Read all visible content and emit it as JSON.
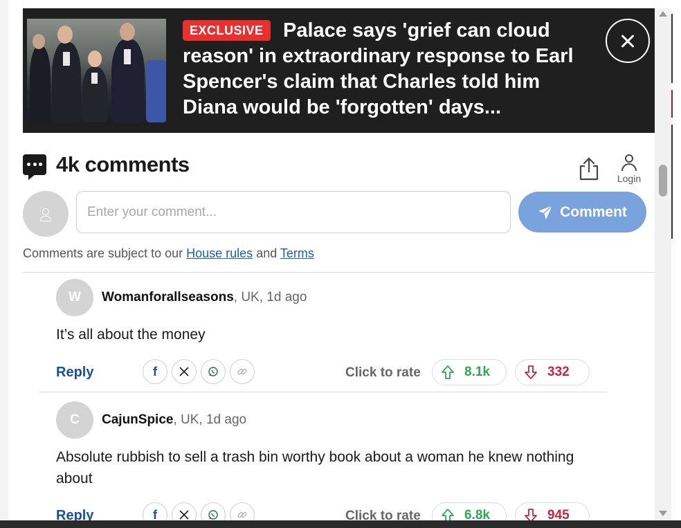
{
  "banner": {
    "badge": "EXCLUSIVE",
    "headline": "Palace says 'grief can cloud reason' in extraordinary response to Earl Spencer's claim that Charles told him Diana would be 'forgotten' days..."
  },
  "comments_section": {
    "title": "4k comments",
    "login_label": "Login",
    "input_placeholder": "Enter your comment...",
    "submit_label": "Comment",
    "rules_prefix": "Comments are subject to our",
    "house_rules_link": "House rules",
    "rules_and": "and",
    "terms_link": "Terms"
  },
  "comments": [
    {
      "initial": "W",
      "author": "Womanforallseasons",
      "meta": ", UK, 1d ago",
      "body": "It’s all about the money",
      "reply_label": "Reply",
      "rate_label": "Click to rate",
      "upvotes": "8.1k",
      "downvotes": "332"
    },
    {
      "initial": "C",
      "author": "CajunSpice",
      "meta": ", UK, 1d ago",
      "body": "Absolute rubbish to sell a trash bin worthy book about a woman he knew nothing about",
      "reply_label": "Reply",
      "rate_label": "Click to rate",
      "upvotes": "6.8k",
      "downvotes": "945"
    }
  ],
  "share_icons": [
    "facebook-icon",
    "x-icon",
    "whatsapp-icon",
    "link-icon"
  ],
  "colors": {
    "banner_bg": "#1f1f1f",
    "badge": "#e8312f",
    "comment_button": "#7aa2dc",
    "link": "#1b5fb4",
    "reply": "#1b4e9c",
    "upvote": "#2fa84f",
    "downvote": "#c8233b"
  }
}
